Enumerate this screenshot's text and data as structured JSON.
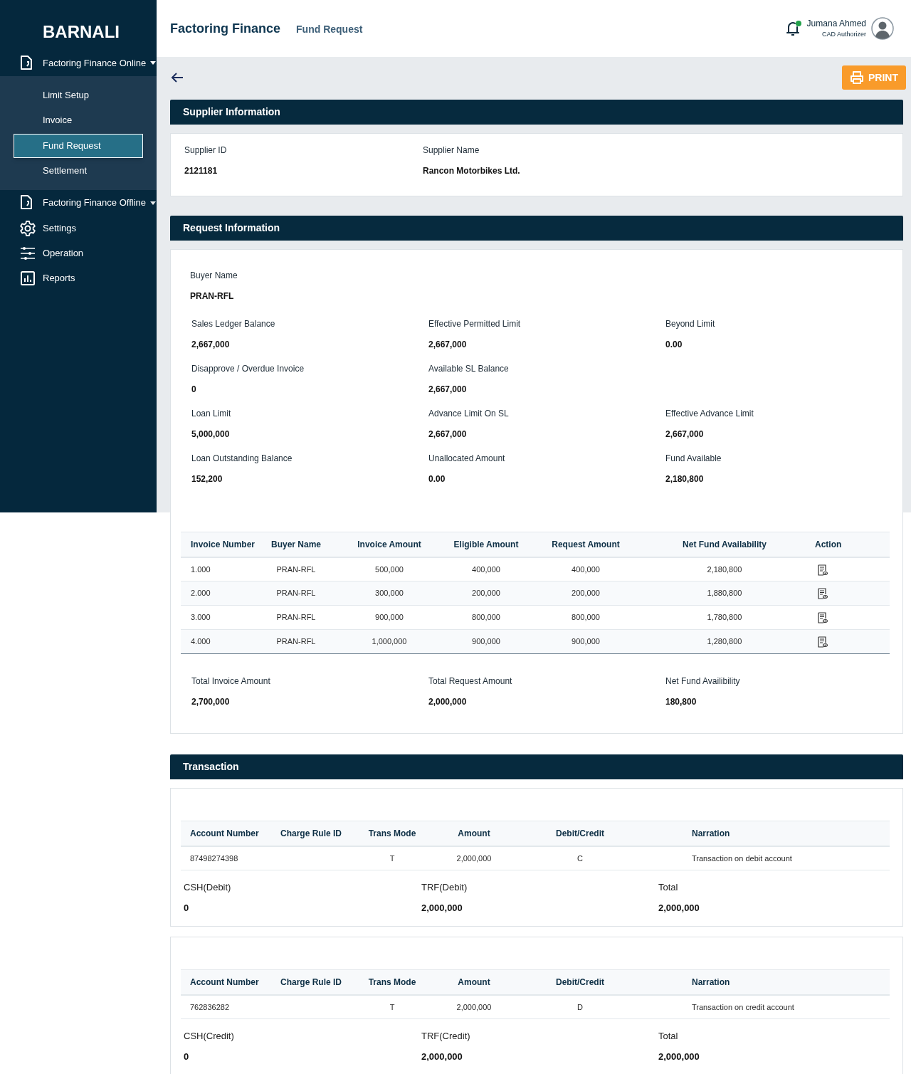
{
  "sidebar": {
    "brand": "BARNALI",
    "items": [
      {
        "label": "Factoring Finance Online",
        "kind": "menu",
        "expanded": true,
        "children": [
          {
            "label": "Limit Setup",
            "selected": false
          },
          {
            "label": "Invoice",
            "selected": false
          },
          {
            "label": "Fund Request",
            "selected": true
          },
          {
            "label": "Settlement",
            "selected": false
          }
        ]
      },
      {
        "label": "Factoring Finance Offline",
        "kind": "menu",
        "expanded": false
      },
      {
        "label": "Settings",
        "kind": "link"
      },
      {
        "label": "Operation",
        "kind": "link"
      },
      {
        "label": "Reports",
        "kind": "link"
      }
    ]
  },
  "header": {
    "title": "Factoring Finance",
    "subtitle": "Fund Request",
    "notification": true,
    "user": {
      "name": "Jumana Ahmed",
      "role": "CAD Authorizer"
    }
  },
  "toolbar": {
    "print_button": "PRINT"
  },
  "supplier": {
    "title": "Supplier Information",
    "fields": [
      {
        "label": "Supplier ID",
        "value": "2121181"
      },
      {
        "label": "Supplier Name",
        "value": "Rancon Motorbikes Ltd."
      }
    ]
  },
  "request": {
    "title": "Request Information",
    "buyer": {
      "label": "Buyer Name",
      "value": "PRAN-RFL"
    },
    "field_rows": [
      [
        {
          "label": "Sales Ledger Balance",
          "value": "2,667,000"
        },
        {
          "label": "Effective Permitted Limit",
          "value": "2,667,000"
        },
        {
          "label": "Beyond Limit",
          "value": "0.00"
        }
      ],
      [
        {
          "label": "Disapprove / Overdue Invoice",
          "value": "0"
        },
        {
          "label": "Available SL Balance",
          "value": "2,667,000"
        }
      ],
      [
        {
          "label": "Loan Limit",
          "value": "5,000,000"
        },
        {
          "label": "Advance Limit On SL",
          "value": "2,667,000"
        },
        {
          "label": "Effective Advance Limit",
          "value": "2,667,000"
        }
      ],
      [
        {
          "label": "Loan Outstanding Balance",
          "value": "152,200"
        },
        {
          "label": "Unallocated Amount",
          "value": "0.00"
        },
        {
          "label": "Fund Available",
          "value": "2,180,800"
        }
      ]
    ],
    "invoice_table": {
      "columns": [
        "Invoice Number",
        "Buyer Name",
        "Invoice Amount",
        "Eligible Amount",
        "Request Amount",
        "Net Fund Availability",
        "Action"
      ],
      "rows": [
        [
          "1.000",
          "PRAN-RFL",
          "500,000",
          "400,000",
          "400,000",
          "2,180,800"
        ],
        [
          "2.000",
          "PRAN-RFL",
          "300,000",
          "200,000",
          "200,000",
          "1,880,800"
        ],
        [
          "3.000",
          "PRAN-RFL",
          "900,000",
          "800,000",
          "800,000",
          "1,780,800"
        ],
        [
          "4.000",
          "PRAN-RFL",
          "1,000,000",
          "900,000",
          "900,000",
          "1,280,800"
        ]
      ]
    },
    "totals": [
      {
        "label": "Total Invoice Amount",
        "value": "2,700,000"
      },
      {
        "label": "Total Request Amount",
        "value": "2,000,000"
      },
      {
        "label": "Net Fund Availibility",
        "value": "180,800"
      }
    ]
  },
  "transaction": {
    "title": "Transaction",
    "tables": [
      {
        "columns": [
          "Account Number",
          "Charge Rule ID",
          "Trans Mode",
          "Amount",
          "Debit/Credit",
          "Narration"
        ],
        "rows": [
          [
            "87498274398",
            "",
            "T",
            "2,000,000",
            "C",
            "Transaction on debit account"
          ]
        ],
        "totals": [
          {
            "label": "CSH(Debit)",
            "value": "0"
          },
          {
            "label": "TRF(Debit)",
            "value": "2,000,000"
          },
          {
            "label": "Total",
            "value": "2,000,000"
          }
        ]
      },
      {
        "columns": [
          "Account Number",
          "Charge Rule ID",
          "Trans Mode",
          "Amount",
          "Debit/Credit",
          "Narration"
        ],
        "rows": [
          [
            "762836282",
            "",
            "T",
            "2,000,000",
            "D",
            "Transaction on credit account"
          ]
        ],
        "totals": [
          {
            "label": "CSH(Credit)",
            "value": "0"
          },
          {
            "label": "TRF(Credit)",
            "value": "2,000,000"
          },
          {
            "label": "Total",
            "value": "2,000,000"
          }
        ]
      }
    ]
  }
}
